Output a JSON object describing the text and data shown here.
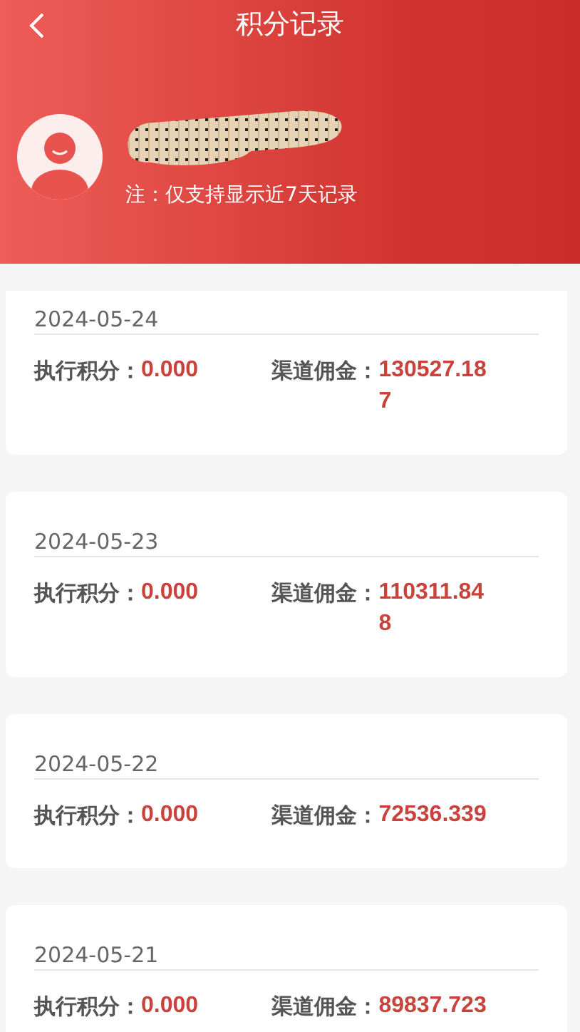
{
  "header": {
    "title": "积分记录",
    "note": "注：仅支持显示近7天记录"
  },
  "records": [
    {
      "date": "2024-05-24",
      "points_label": "执行积分：",
      "points": "0.000",
      "commission_label": "渠道佣金：",
      "commission": "130527.187"
    },
    {
      "date": "2024-05-23",
      "points_label": "执行积分：",
      "points": "0.000",
      "commission_label": "渠道佣金：",
      "commission": "110311.848"
    },
    {
      "date": "2024-05-22",
      "points_label": "执行积分：",
      "points": "0.000",
      "commission_label": "渠道佣金：",
      "commission": "72536.339"
    },
    {
      "date": "2024-05-21",
      "points_label": "执行积分：",
      "points": "0.000",
      "commission_label": "渠道佣金：",
      "commission": "89837.723"
    }
  ]
}
